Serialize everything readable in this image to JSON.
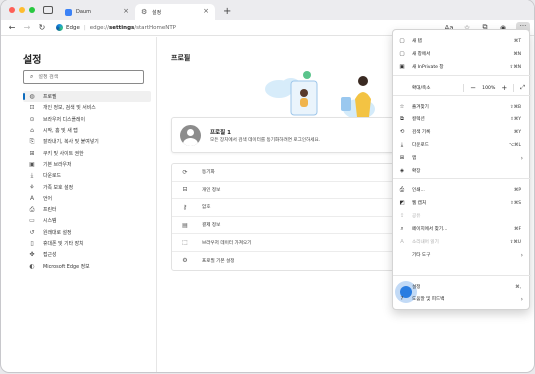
{
  "tabs": [
    {
      "title": "Daum"
    },
    {
      "title": "설정"
    }
  ],
  "toolbar": {
    "app_label": "Edge",
    "url_host": "edge://",
    "url_path": "settings",
    "url_rest": "/startHomeNTP"
  },
  "sidebar": {
    "title": "설정",
    "search_placeholder": "설정 검색",
    "items": [
      {
        "label": "프로필",
        "icon": "person-icon"
      },
      {
        "label": "개인 정보, 검색 및 서비스",
        "icon": "lock-icon"
      },
      {
        "label": "브라우저 디스플레이",
        "icon": "display-icon"
      },
      {
        "label": "시작, 홈 및 새 탭",
        "icon": "home-icon"
      },
      {
        "label": "잘라내기, 복사 및 붙여넣기",
        "icon": "clipboard-icon"
      },
      {
        "label": "쿠키 및 사이트 권한",
        "icon": "cookie-icon"
      },
      {
        "label": "기본 브라우저",
        "icon": "browser-icon"
      },
      {
        "label": "다운로드",
        "icon": "download-icon"
      },
      {
        "label": "가족 보호 설정",
        "icon": "family-icon"
      },
      {
        "label": "언어",
        "icon": "language-icon"
      },
      {
        "label": "프린터",
        "icon": "printer-icon"
      },
      {
        "label": "시스템",
        "icon": "system-icon"
      },
      {
        "label": "원래대로 설정",
        "icon": "reset-icon"
      },
      {
        "label": "휴대폰 및 기타 장치",
        "icon": "phone-icon"
      },
      {
        "label": "접근성",
        "icon": "accessibility-icon"
      },
      {
        "label": "Microsoft Edge 정보",
        "icon": "edge-icon"
      }
    ],
    "active_index": 0
  },
  "main": {
    "title": "프로필",
    "profile_name": "프로필 1",
    "profile_desc": "모든 장치에서 검색 데이터를 동기화하려면 로그인하세요.",
    "rows": [
      {
        "label": "동기화",
        "icon": "sync-icon"
      },
      {
        "label": "개인 정보",
        "icon": "user-info-icon"
      },
      {
        "label": "암호",
        "icon": "key-icon"
      },
      {
        "label": "결제 정보",
        "icon": "card-icon"
      },
      {
        "label": "브라우저 데이터 가져오기",
        "icon": "import-icon"
      },
      {
        "label": "프로필 기본 설정",
        "icon": "profile-settings-icon"
      }
    ]
  },
  "menu": {
    "items": [
      {
        "label": "새 탭",
        "shortcut": "⌘T"
      },
      {
        "label": "새 창에서",
        "shortcut": "⌘N"
      },
      {
        "label": "새 InPrivate 창",
        "shortcut": "⇧⌘N"
      },
      {
        "label": "확대/축소",
        "zoom": "100%"
      },
      {
        "label": "즐겨찾기",
        "shortcut": "⇧⌘B"
      },
      {
        "label": "컬렉션",
        "shortcut": "⇧⌘Y"
      },
      {
        "label": "검색 기록",
        "shortcut": "⌘Y"
      },
      {
        "label": "다운로드",
        "shortcut": "⌥⌘L"
      },
      {
        "label": "앱"
      },
      {
        "label": "확장"
      },
      {
        "label": "인쇄...",
        "shortcut": "⌘P"
      },
      {
        "label": "웹 캡처",
        "shortcut": "⇧⌘S"
      },
      {
        "label": "공유"
      },
      {
        "label": "페이지에서 찾기...",
        "shortcut": "⌘F"
      },
      {
        "label": "소리내어 읽기",
        "shortcut": "⇧⌘U"
      },
      {
        "label": "기타 도구"
      },
      {
        "label": "설정",
        "shortcut": "⌘,"
      },
      {
        "label": "도움말 및 피드백"
      }
    ]
  }
}
